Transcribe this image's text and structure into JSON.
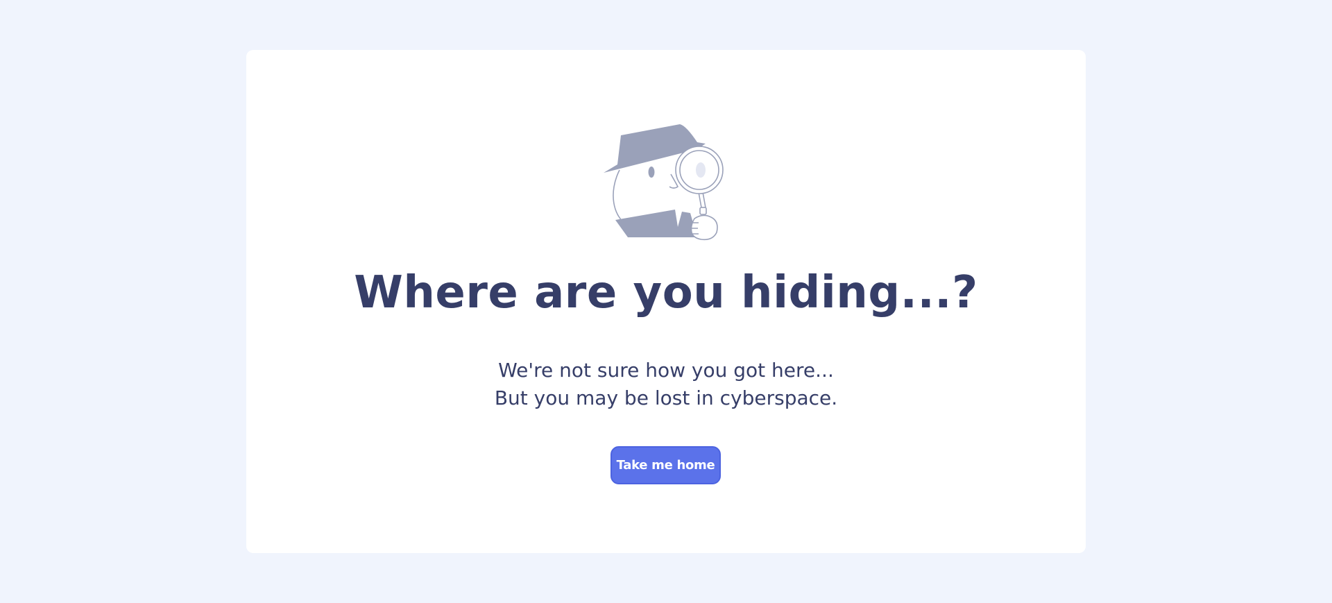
{
  "illustration": {
    "icon": "detective-with-magnifying-glass-icon",
    "colors": {
      "fill": "#9aa1b9",
      "stroke": "#9aa1b9",
      "lens": "#e4e7f2"
    }
  },
  "error": {
    "title": "Where are you hiding...?",
    "message_line1": "We're not sure how you got here...",
    "message_line2": "But you may be lost in cyberspace."
  },
  "actions": {
    "home_label": "Take me home"
  },
  "colors": {
    "background": "#f0f4fd",
    "card": "#ffffff",
    "text": "#363e68",
    "accent": "#5b72ea"
  }
}
